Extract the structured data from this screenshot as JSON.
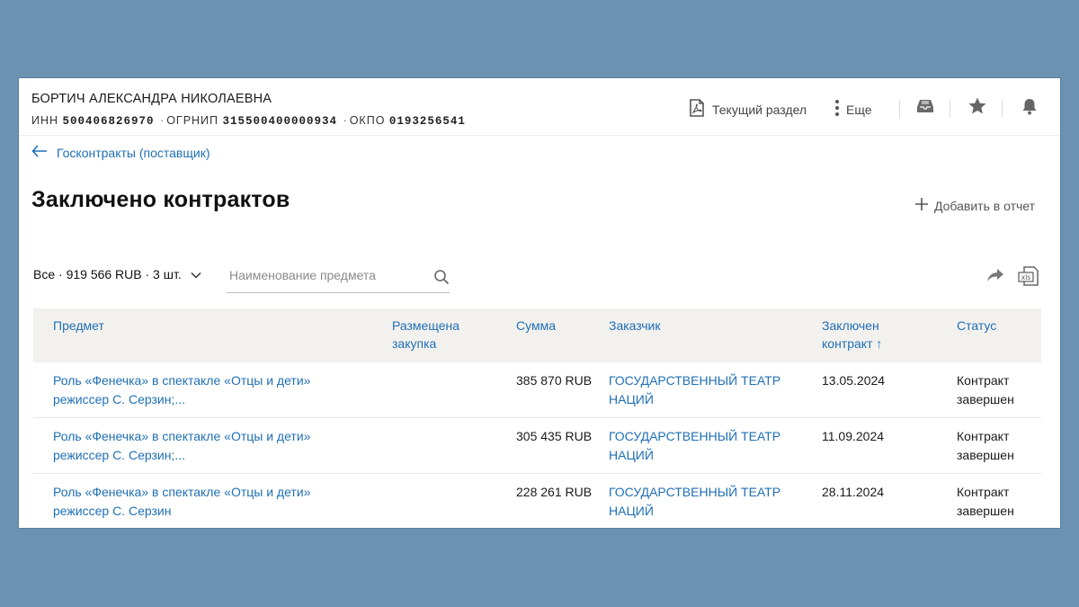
{
  "company": {
    "name": "БОРТИЧ АЛЕКСАНДРА НИКОЛАЕВНА",
    "inn_label": "ИНН",
    "inn": "500406826970",
    "ogrnip_label": "ОГРНИП",
    "ogrnip": "315500400000934",
    "okpo_label": "ОКПО",
    "okpo": "0193256541",
    "separator": "·"
  },
  "header_actions": {
    "current_section": "Текущий раздел",
    "more": "Еще"
  },
  "breadcrumb": "Госконтракты (поставщик)",
  "page_title": "Заключено контрактов",
  "add_to_report": "Добавить в отчет",
  "filter": {
    "selected": "Все · 919 566 RUB · 3 шт.",
    "search_placeholder": "Наименование предмета"
  },
  "table": {
    "headers": {
      "subject": "Предмет",
      "purchase": "Размещена закупка",
      "sum": "Сумма",
      "customer": "Заказчик",
      "concluded": "Заключен контракт ↑",
      "status": "Статус"
    },
    "rows": [
      {
        "subject": "Роль «Фенечка» в спектакле «Отцы и дети» режиссер С. Серзин;...",
        "purchase": "",
        "sum": "385 870 RUB",
        "customer": "ГОСУДАРСТВЕННЫЙ ТЕАТР НАЦИЙ",
        "concluded": "13.05.2024",
        "status": "Контракт завершен"
      },
      {
        "subject": "Роль «Фенечка» в спектакле «Отцы и дети» режиссер С. Серзин;...",
        "purchase": "",
        "sum": "305 435 RUB",
        "customer": "ГОСУДАРСТВЕННЫЙ ТЕАТР НАЦИЙ",
        "concluded": "11.09.2024",
        "status": "Контракт завершен"
      },
      {
        "subject": "Роль «Фенечка» в спектакле «Отцы и дети» режиссер С. Серзин",
        "purchase": "",
        "sum": "228 261 RUB",
        "customer": "ГОСУДАРСТВЕННЫЙ ТЕАТР НАЦИЙ",
        "concluded": "28.11.2024",
        "status": "Контракт завершен"
      }
    ]
  },
  "colors": {
    "background": "#6b93b1",
    "link": "#1f6fb5",
    "table_header_bg": "#f3f1ee"
  },
  "icons": {
    "pdf": "pdf-icon",
    "more": "kebab-icon",
    "inbox": "inbox-icon",
    "star": "star-icon",
    "bell": "bell-icon",
    "back": "arrow-left-icon",
    "plus": "plus-icon",
    "chevron": "chevron-down-icon",
    "search": "search-icon",
    "share": "share-icon",
    "xls": "xls-icon"
  }
}
